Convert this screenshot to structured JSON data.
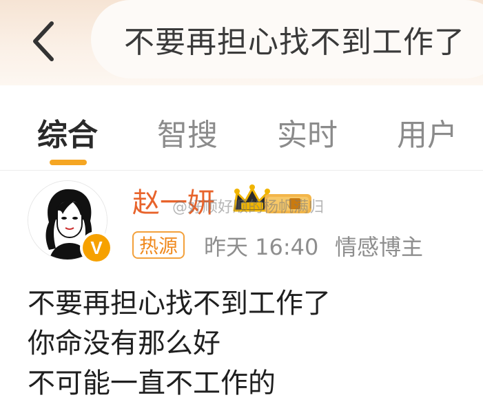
{
  "header": {
    "back_icon": "chevron-left-icon",
    "search_query": "不要再担心找不到工作了"
  },
  "tabs": [
    {
      "label": "综合",
      "active": true
    },
    {
      "label": "智搜",
      "active": false
    },
    {
      "label": "实时",
      "active": false
    },
    {
      "label": "用户",
      "active": false
    }
  ],
  "post": {
    "author": "赵一妍",
    "badge_icon": "crown-level-icon",
    "verified_mark": "V",
    "watermark": "@好顺好顺的杨帆满归",
    "source_tag": "热源",
    "time": "昨天 16:40",
    "role": "情感博主",
    "content_lines": [
      "不要再担心找不到工作了",
      "你命没有那么好",
      "不可能一直不工作的"
    ]
  },
  "colors": {
    "accent": "#f5a623",
    "username": "#e8632b",
    "tag": "#f08a1f"
  }
}
